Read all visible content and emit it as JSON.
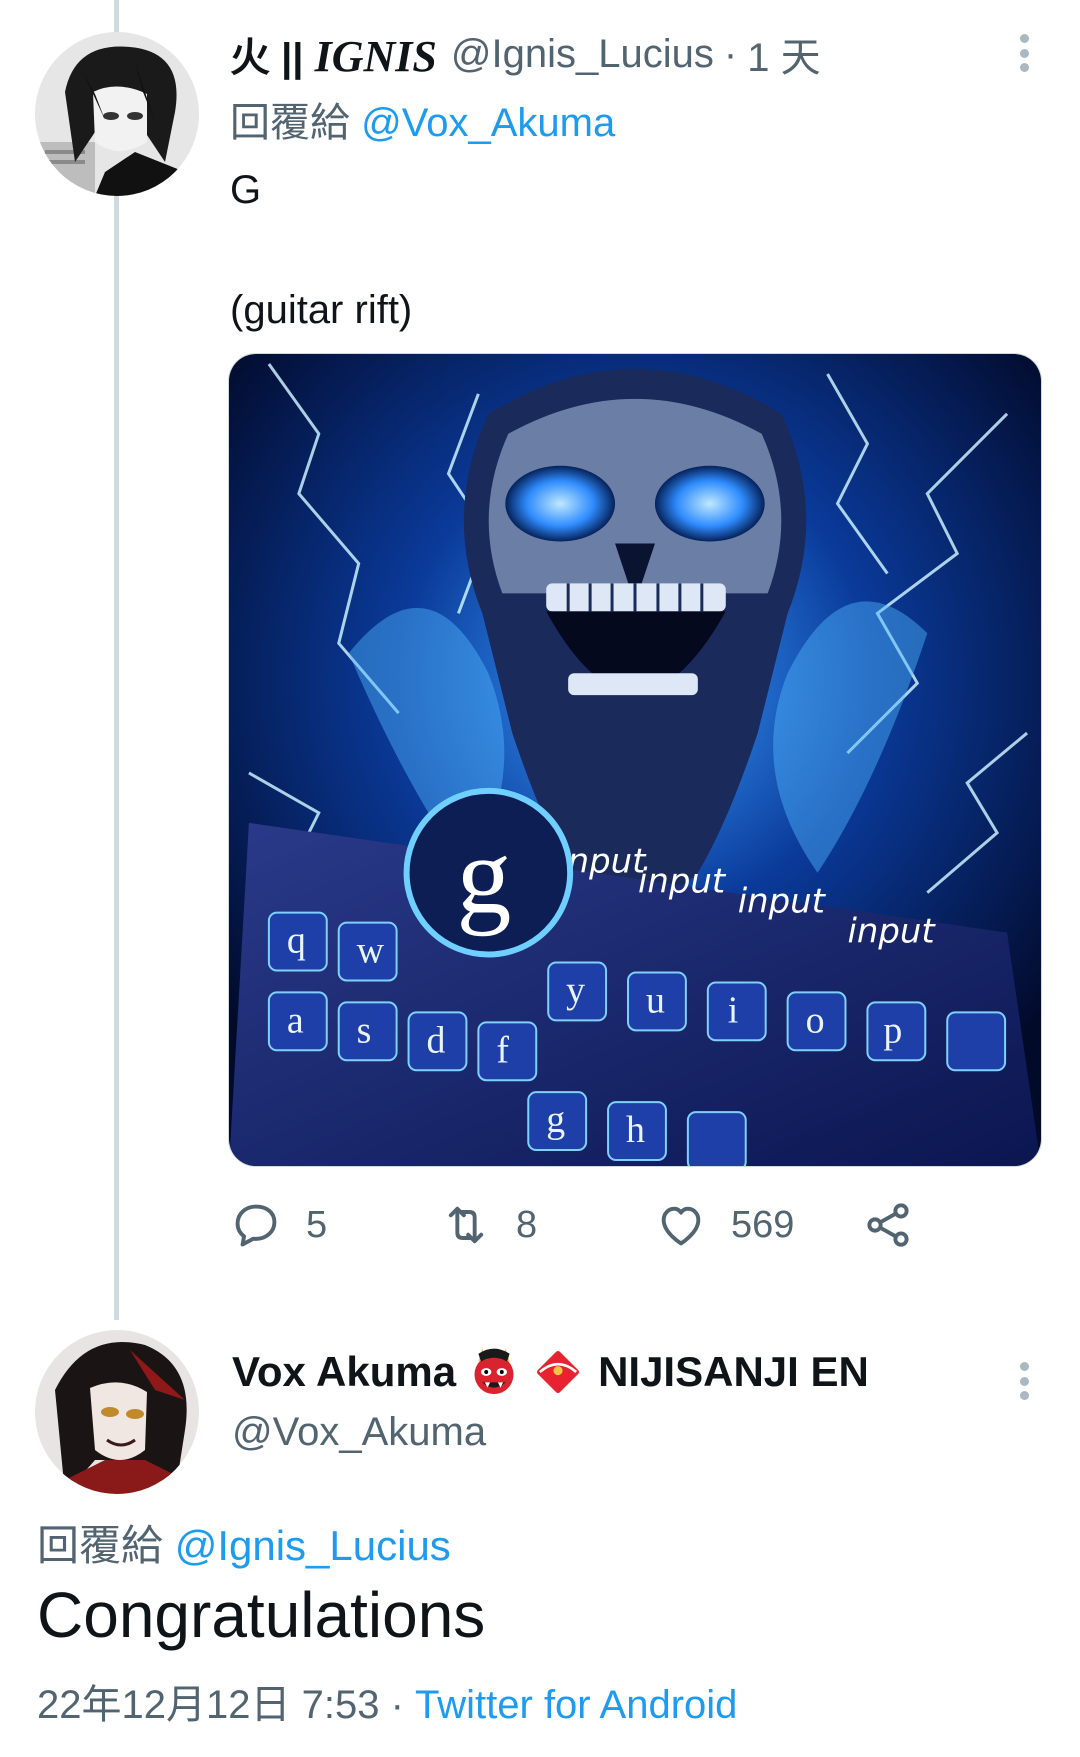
{
  "tweet1": {
    "name_prefix": "火 ||",
    "name_main": "IGNIS",
    "handle": "@Ignis_Lucius",
    "separator": "·",
    "time": "1 天",
    "reply_prefix": "回覆給",
    "reply_to": "@Vox_Akuma",
    "text": "G\n\n(guitar rift)",
    "media_alt_labels": [
      "input",
      "input",
      "input",
      "input"
    ],
    "actions": {
      "reply_count": "5",
      "retweet_count": "8",
      "like_count": "569"
    }
  },
  "tweet2": {
    "name": "Vox Akuma",
    "name_suffix": "NIJISANJI EN",
    "handle": "@Vox_Akuma",
    "reply_prefix": "回覆給",
    "reply_to": "@Ignis_Lucius",
    "text": "Congratulations",
    "timestamp": "22年12月12日 7:53",
    "separator": "·",
    "source": "Twitter for Android"
  },
  "colors": {
    "accent": "#1d9bf0",
    "secondary_text": "#536471",
    "primary_text": "#0f1419",
    "thread_line": "#cfd9de"
  },
  "icons": [
    "more-icon",
    "reply-icon",
    "retweet-icon",
    "like-icon",
    "share-icon",
    "oni-emoji-icon",
    "red-envelope-emoji-icon"
  ]
}
